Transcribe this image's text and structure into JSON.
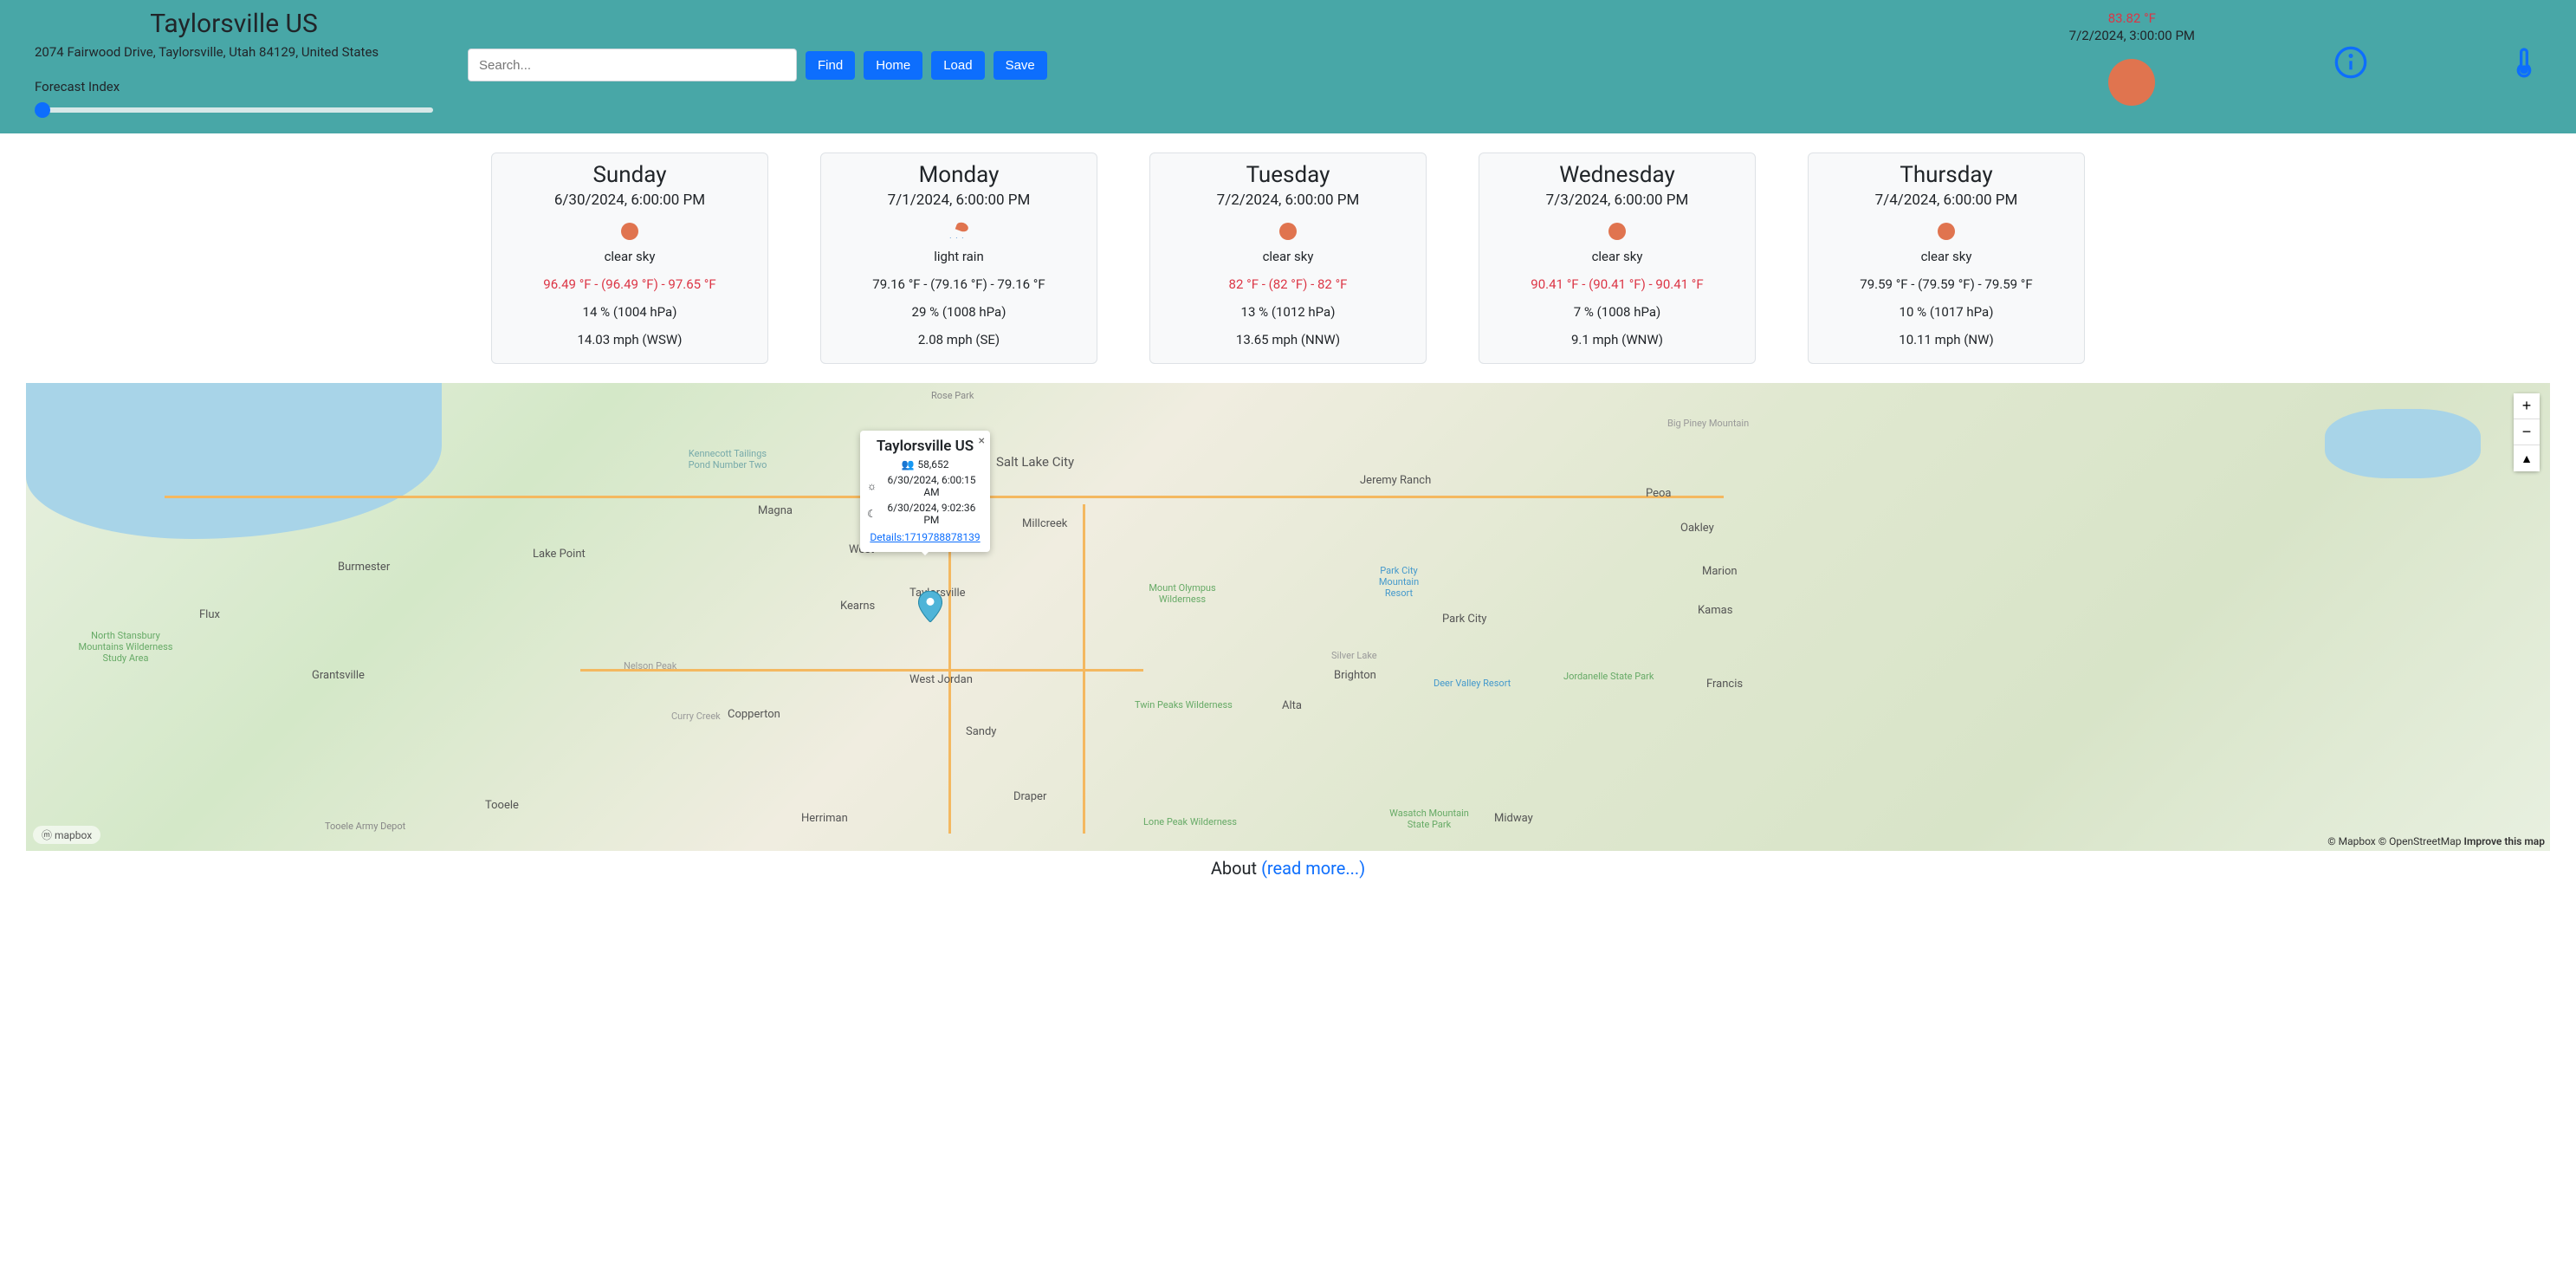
{
  "header": {
    "city": "Taylorsville US",
    "address": "2074 Fairwood Drive, Taylorsville, Utah 84129, United States",
    "forecast_label": "Forecast Index",
    "search_placeholder": "Search...",
    "buttons": {
      "find": "Find",
      "home": "Home",
      "load": "Load",
      "save": "Save"
    },
    "current_temp": "83.82 °F",
    "current_time": "7/2/2024, 3:00:00 PM"
  },
  "forecast": [
    {
      "day": "Sunday",
      "date": "6/30/2024, 6:00:00 PM",
      "icon": "sun",
      "desc": "clear sky",
      "temp": "96.49 °F - (96.49 °F) - 97.65 °F",
      "hot": true,
      "hum": "14 % (1004 hPa)",
      "wind": "14.03 mph (WSW)"
    },
    {
      "day": "Monday",
      "date": "7/1/2024, 6:00:00 PM",
      "icon": "rain",
      "desc": "light rain",
      "temp": "79.16 °F - (79.16 °F) - 79.16 °F",
      "hot": false,
      "hum": "29 % (1008 hPa)",
      "wind": "2.08 mph (SE)"
    },
    {
      "day": "Tuesday",
      "date": "7/2/2024, 6:00:00 PM",
      "icon": "sun",
      "desc": "clear sky",
      "temp": "82 °F - (82 °F) - 82 °F",
      "hot": true,
      "hum": "13 % (1012 hPa)",
      "wind": "13.65 mph (NNW)"
    },
    {
      "day": "Wednesday",
      "date": "7/3/2024, 6:00:00 PM",
      "icon": "sun",
      "desc": "clear sky",
      "temp": "90.41 °F - (90.41 °F) - 90.41 °F",
      "hot": true,
      "hum": "7 % (1008 hPa)",
      "wind": "9.1 mph (WNW)"
    },
    {
      "day": "Thursday",
      "date": "7/4/2024, 6:00:00 PM",
      "icon": "sun",
      "desc": "clear sky",
      "temp": "79.59 °F - (79.59 °F) - 79.59 °F",
      "hot": false,
      "hum": "10 % (1017 hPa)",
      "wind": "10.11 mph (NW)"
    }
  ],
  "popup": {
    "title": "Taylorsville US",
    "population": "58,652",
    "sunrise": "6/30/2024, 6:00:15 AM",
    "sunset": "6/30/2024, 9:02:36 PM",
    "details_link": "Details:1719788878139"
  },
  "map": {
    "labels": {
      "slc": "Salt Lake City",
      "millcreek": "Millcreek",
      "westjordan": "West Jordan",
      "sandy": "Sandy",
      "draper": "Draper",
      "herriman": "Herriman",
      "magna": "Magna",
      "tooele": "Tooele",
      "grantsville": "Grantsville",
      "lakepoint": "Lake Point",
      "parkcity": "Park City",
      "brighton": "Brighton",
      "kamas": "Kamas",
      "oakley": "Oakley",
      "francis": "Francis",
      "marion": "Marion",
      "peoa": "Peoa",
      "alta": "Alta",
      "midway": "Midway",
      "copperton": "Copperton",
      "burmester": "Burmester",
      "flux": "Flux",
      "kearns": "Kearns",
      "taylorsville": "Taylorsville",
      "rosepark": "Rose Park",
      "jeremy": "Jeremy Ranch",
      "kennecott": "Kennecott Tailings Pond Number Two",
      "currycreek": "Curry Creek",
      "nelsonpeak": "Nelson Peak",
      "stansbury": "North Stansbury Mountains Wilderness Study Area",
      "tooelearmy": "Tooele Army Depot",
      "olympus": "Mount Olympus Wilderness",
      "twinpeaks": "Twin Peaks Wilderness",
      "lonepeak": "Lone Peak Wilderness",
      "wasatch": "Wasatch Mountain State Park",
      "deervalley": "Deer Valley Resort",
      "canyons": "Park City Mountain Resort",
      "silverlake": "Silver Lake",
      "bigpiney": "Big Piney Mountain",
      "jordanelle": "Jordanelle State Park",
      "westlabel": "West"
    },
    "logo": "ⓜ mapbox",
    "attrib_mapbox": "© Mapbox",
    "attrib_osm": "© OpenStreetMap",
    "attrib_improve": "Improve this map"
  },
  "footer": {
    "about": "About",
    "link": "(read more...)"
  }
}
